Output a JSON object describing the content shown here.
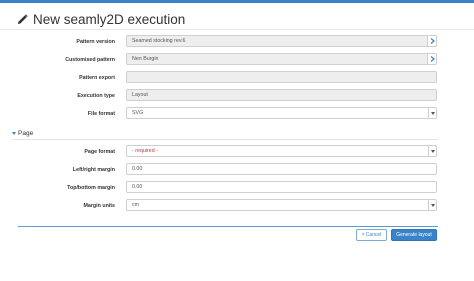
{
  "header": {
    "title": "New seamly2D execution",
    "icon": "pencil-icon",
    "accent_color": "#3a83c8"
  },
  "form": {
    "pattern_version": {
      "label": "Pattern version",
      "value": "Seamed stocking rev.6"
    },
    "customised_pattern": {
      "label": "Customised pattern",
      "value": "Nen Burgin"
    },
    "pattern_export": {
      "label": "Pattern export",
      "value": ""
    },
    "execution_type": {
      "label": "Execution type",
      "value": "Layout"
    },
    "file_format": {
      "label": "File format",
      "value": "SVG"
    }
  },
  "page_section": {
    "legend": "Page",
    "page_format": {
      "label": "Page format",
      "value": "- required -"
    },
    "lr_margin": {
      "label": "Left/right margin",
      "value": "0.00"
    },
    "tb_margin": {
      "label": "Top/bottom margin",
      "value": "0.00"
    },
    "margin_units": {
      "label": "Margin units",
      "value": "cm"
    }
  },
  "buttons": {
    "cancel": "Cancel",
    "generate": "Generate layout"
  }
}
